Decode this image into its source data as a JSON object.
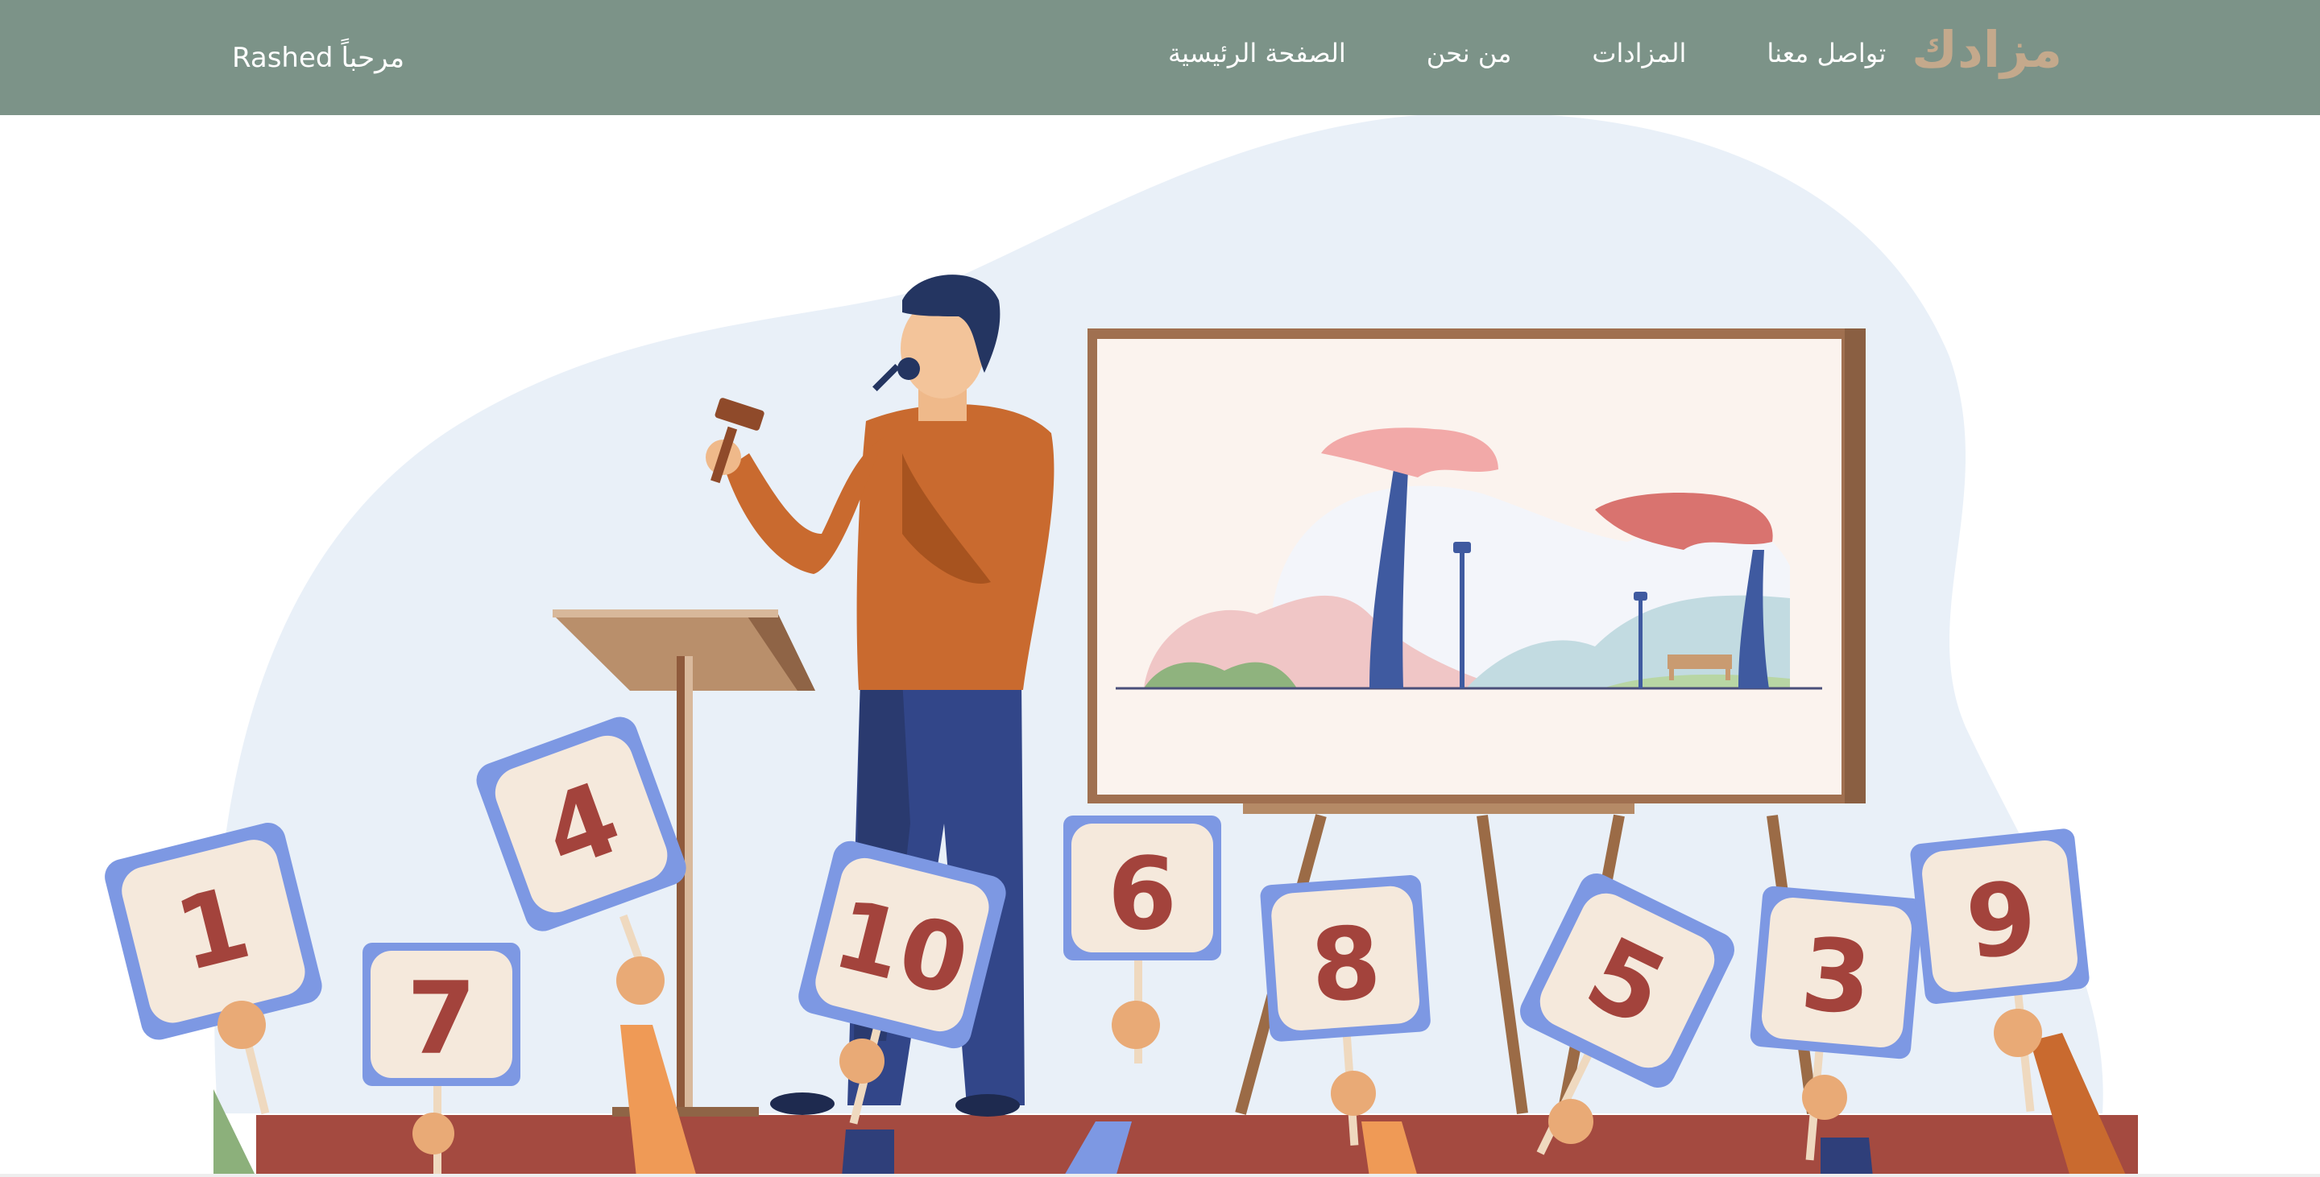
{
  "navbar": {
    "brand": "مزادك",
    "links": [
      "الصفحة الرئيسية",
      "من نحن",
      "المزادات",
      "تواصل معنا"
    ],
    "greeting_word": "مرحباً",
    "username": "Rashed"
  },
  "hero": {
    "paddle_numbers": [
      "1",
      "7",
      "4",
      "10",
      "6",
      "8",
      "5",
      "3",
      "9"
    ]
  },
  "colors": {
    "navbar_bg": "#7c9388",
    "brand_color": "#c4a98c",
    "stage_red": "#a44a40",
    "blob_blue": "#e9f0f8"
  }
}
